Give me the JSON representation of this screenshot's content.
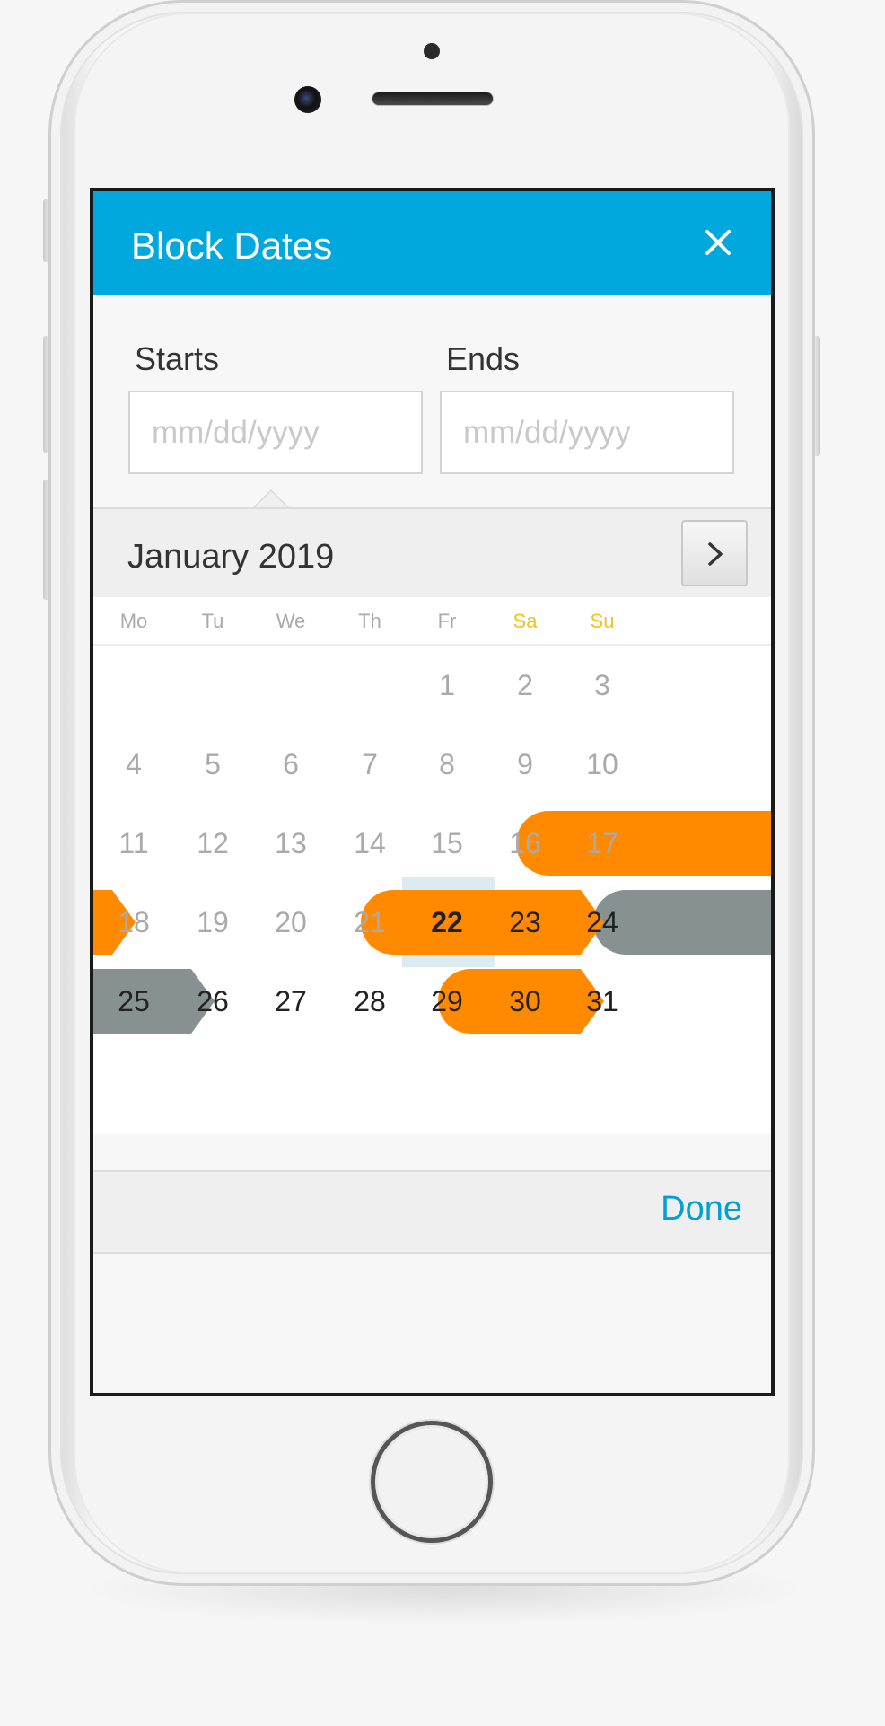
{
  "modal": {
    "title": "Block Dates",
    "header_color": "#00a8dd"
  },
  "form": {
    "starts_label": "Starts",
    "ends_label": "Ends",
    "starts_placeholder": "mm/dd/yyyy",
    "ends_placeholder": "mm/dd/yyyy",
    "starts_value": "",
    "ends_value": ""
  },
  "calendar": {
    "month_label": "January 2019",
    "weekdays": [
      "Mo",
      "Tu",
      "We",
      "Th",
      "Fr",
      "Sa",
      "Su"
    ],
    "weekend_color": "#f3c21b",
    "today": 22,
    "active_from": 22,
    "blocked_color": "#ff8a00",
    "booked_color": "#879191",
    "blocked_ranges": [
      {
        "start": 16,
        "end": 18
      },
      {
        "start": 21,
        "end": 24
      },
      {
        "start": 29,
        "end": 31
      }
    ],
    "booked_ranges": [
      {
        "start": 24,
        "end": 26
      }
    ],
    "days": [
      "1",
      "2",
      "3",
      "4",
      "5",
      "6",
      "7",
      "8",
      "9",
      "10",
      "11",
      "12",
      "13",
      "14",
      "15",
      "16",
      "17",
      "18",
      "19",
      "20",
      "21",
      "22",
      "23",
      "24",
      "25",
      "26",
      "27",
      "28",
      "29",
      "30",
      "31"
    ]
  },
  "footer": {
    "done_label": "Done",
    "done_color": "#00a0d6"
  }
}
